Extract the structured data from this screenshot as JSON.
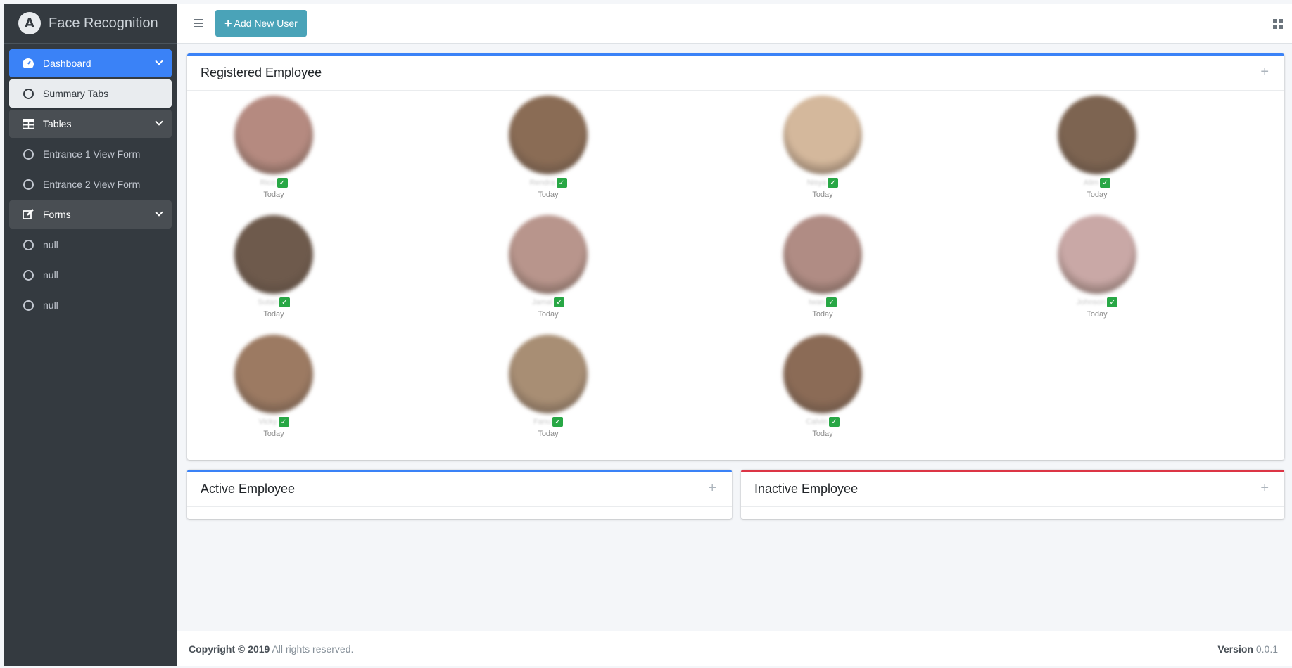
{
  "brand": {
    "logo_letter": "A",
    "title": "Face Recognition"
  },
  "sidebar": {
    "items": [
      {
        "label": "Dashboard",
        "icon": "tachometer-icon",
        "type": "active-parent"
      },
      {
        "label": "Summary Tabs",
        "icon": "circle-icon",
        "type": "selected"
      },
      {
        "label": "Tables",
        "icon": "table-icon",
        "type": "parent"
      },
      {
        "label": "Entrance 1 View Form",
        "icon": "circle-icon",
        "type": "child"
      },
      {
        "label": "Entrance 2 View Form",
        "icon": "circle-icon",
        "type": "child"
      },
      {
        "label": "Forms",
        "icon": "edit-icon",
        "type": "parent"
      },
      {
        "label": "null",
        "icon": "circle-icon",
        "type": "child"
      },
      {
        "label": "null",
        "icon": "circle-icon",
        "type": "child"
      },
      {
        "label": "null",
        "icon": "circle-icon",
        "type": "child"
      }
    ]
  },
  "navbar": {
    "add_user_label": "Add New User"
  },
  "registered": {
    "title": "Registered Employee",
    "employees": [
      {
        "name": "Rico",
        "date": "Today",
        "avatar_color": "#b58a80"
      },
      {
        "name": "Rendra",
        "date": "Today",
        "avatar_color": "#8a6c55"
      },
      {
        "name": "Nisya",
        "date": "Today",
        "avatar_color": "#d4b89c"
      },
      {
        "name": "Alim",
        "date": "Today",
        "avatar_color": "#7d6451"
      },
      {
        "name": "Sutan",
        "date": "Today",
        "avatar_color": "#6e5a4c"
      },
      {
        "name": "Jamal",
        "date": "Today",
        "avatar_color": "#b8958c"
      },
      {
        "name": "Iwan",
        "date": "Today",
        "avatar_color": "#b08c84"
      },
      {
        "name": "Johnson",
        "date": "Today",
        "avatar_color": "#c9a8a6"
      },
      {
        "name": "Vicky",
        "date": "Today",
        "avatar_color": "#9c7a62"
      },
      {
        "name": "Fanu",
        "date": "Today",
        "avatar_color": "#a88e74"
      },
      {
        "name": "Calvin",
        "date": "Today",
        "avatar_color": "#8b6b56"
      }
    ]
  },
  "active": {
    "title": "Active Employee"
  },
  "inactive": {
    "title": "Inactive Employee"
  },
  "footer": {
    "copyright_bold": "Copyright © 2019",
    "copyright_rest": " All rights reserved.",
    "version_label": "Version",
    "version_value": " 0.0.1"
  },
  "colors": {
    "primary": "#3a82f7",
    "danger": "#dc3545",
    "success": "#28a745",
    "info": "#4aa3b8"
  }
}
